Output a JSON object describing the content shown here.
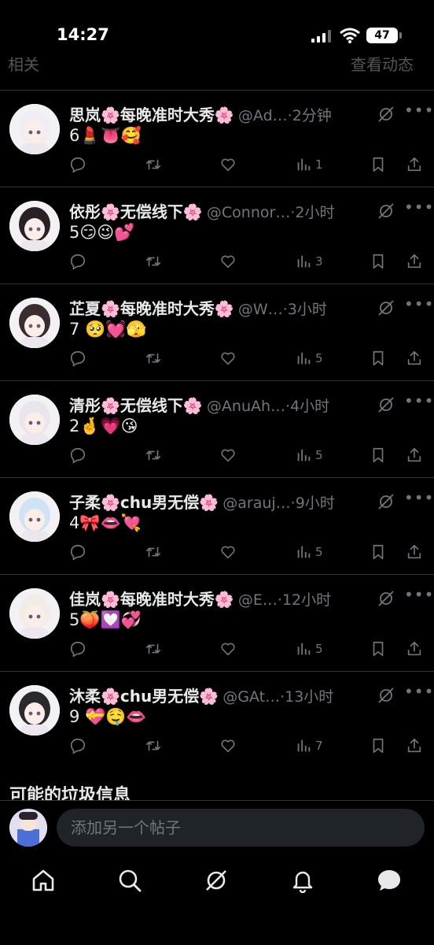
{
  "status_bar": {
    "time": "14:27",
    "battery": "47"
  },
  "header": {
    "left_label": "相关",
    "right_label": "查看动态"
  },
  "posts": [
    {
      "name": "思岚🌸每晚准时大秀🌸",
      "handle": "@Ad…",
      "time": "2分钟",
      "text": "6💄👅🥰",
      "views": "1"
    },
    {
      "name": "依彤🌸无偿线下🌸",
      "handle": "@Connor…",
      "time": "2小时",
      "text": "5😏😉💕",
      "views": "3"
    },
    {
      "name": "芷夏🌸每晚准时大秀🌸",
      "handle": "@W…",
      "time": "3小时",
      "text": "7 🥺💓🫣",
      "views": "5"
    },
    {
      "name": "清彤🌸无偿线下🌸",
      "handle": "@AnuAh…",
      "time": "4小时",
      "text": "2🤞💗😘",
      "views": "5"
    },
    {
      "name": "子柔🌸chu男无偿🌸",
      "handle": "@arauj…",
      "time": "9小时",
      "text": "4🎀👄💘",
      "views": "5"
    },
    {
      "name": "佳岚🌸每晚准时大秀🌸",
      "handle": "@E…",
      "time": "12小时",
      "text": "5🍑💟💞",
      "views": "5"
    },
    {
      "name": "沐柔🌸chu男无偿🌸",
      "handle": "@GAt…",
      "time": "13小时",
      "text": "9 💝🤤👄",
      "views": "7"
    }
  ],
  "section_label": "可能的垃圾信息",
  "composer": {
    "placeholder": "添加另一个帖子"
  },
  "tabbar": [
    "home-icon",
    "search-icon",
    "grok-icon",
    "bell-icon",
    "chat-icon"
  ],
  "colors": {
    "background": "#000000",
    "text": "#e7e9ea",
    "muted": "#71767b",
    "divider": "#2f3336",
    "input": "#202327"
  }
}
